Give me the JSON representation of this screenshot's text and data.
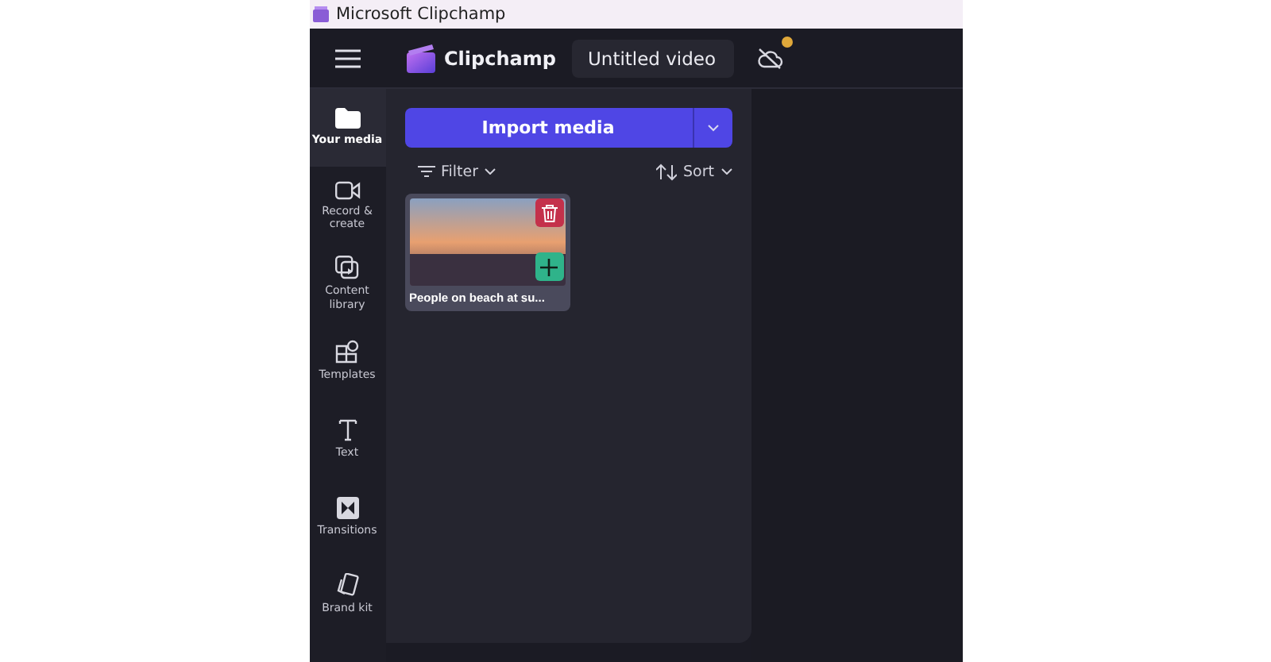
{
  "window": {
    "title": "Microsoft Clipchamp"
  },
  "header": {
    "app_name": "Clipchamp",
    "project_title": "Untitled video"
  },
  "nav": [
    {
      "kind": "media",
      "label": "Your media",
      "selected": true
    },
    {
      "kind": "record",
      "label": "Record & create",
      "selected": false
    },
    {
      "kind": "library",
      "label": "Content library",
      "selected": false
    },
    {
      "kind": "templates",
      "label": "Templates",
      "selected": false
    },
    {
      "kind": "text",
      "label": "Text",
      "selected": false
    },
    {
      "kind": "transitions",
      "label": "Transitions",
      "selected": false
    },
    {
      "kind": "brand",
      "label": "Brand kit",
      "selected": false
    }
  ],
  "panel": {
    "import_button": "Import media",
    "filter": "Filter",
    "sort": "Sort",
    "media": [
      {
        "title": "People on beach at su..."
      }
    ]
  }
}
